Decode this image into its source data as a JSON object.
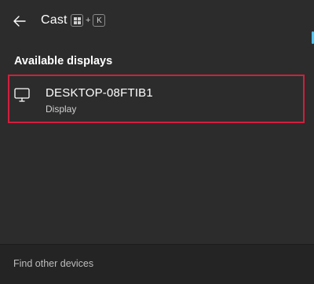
{
  "header": {
    "title": "Cast",
    "shortcut": {
      "win_key": "windows-logo-icon",
      "plus": "+",
      "key": "K"
    },
    "back_icon": "back-arrow-icon"
  },
  "section": {
    "heading": "Available displays"
  },
  "devices": [
    {
      "name": "DESKTOP-08FTIB1",
      "type": "Display",
      "icon": "monitor-icon"
    }
  ],
  "footer": {
    "link": "Find other devices"
  },
  "colors": {
    "panel_bg": "#2c2c2c",
    "footer_bg": "#242424",
    "highlight_border": "#d21f3c",
    "accent": "#4cc2ff"
  }
}
